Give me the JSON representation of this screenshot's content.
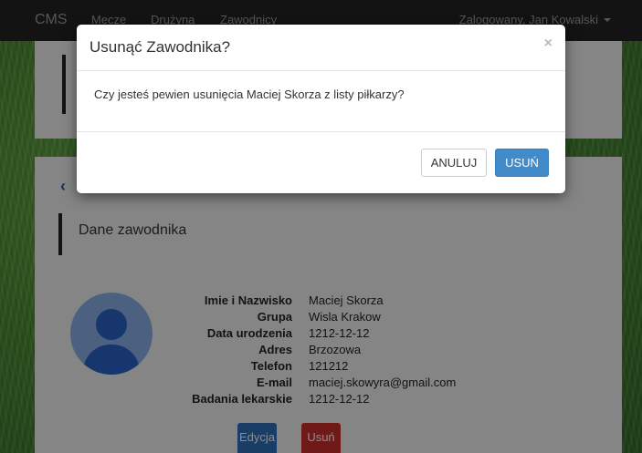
{
  "navbar": {
    "brand": "CMS",
    "links": [
      "Mecze",
      "Drużyna",
      "Zawodnicy"
    ],
    "user": "Zalogowany, Jan Kowalski"
  },
  "page": {
    "section_title": "Dane zawodnika",
    "details": [
      {
        "label": "Imie i Nazwisko",
        "value": "Maciej Skorza"
      },
      {
        "label": "Grupa",
        "value": "Wisla Krakow"
      },
      {
        "label": "Data urodzenia",
        "value": "1212-12-12"
      },
      {
        "label": "Adres",
        "value": "Brzozowa"
      },
      {
        "label": "Telefon",
        "value": "121212"
      },
      {
        "label": "E-mail",
        "value": "maciej.skowyra@gmail.com"
      },
      {
        "label": "Badania lekarskie",
        "value": "1212-12-12"
      }
    ],
    "edit_label": "Edycja",
    "delete_label": "Usuń"
  },
  "modal": {
    "title": "Usunąć Zawodnika?",
    "close_symbol": "×",
    "message": "Czy jesteś pewien usunięcia Maciej Skorza z listy piłkarzy?",
    "cancel_label": "ANULUJ",
    "confirm_label": "USUŃ"
  },
  "colors": {
    "navbar": "#222222",
    "primary": "#428bca",
    "danger": "#c9302c"
  }
}
